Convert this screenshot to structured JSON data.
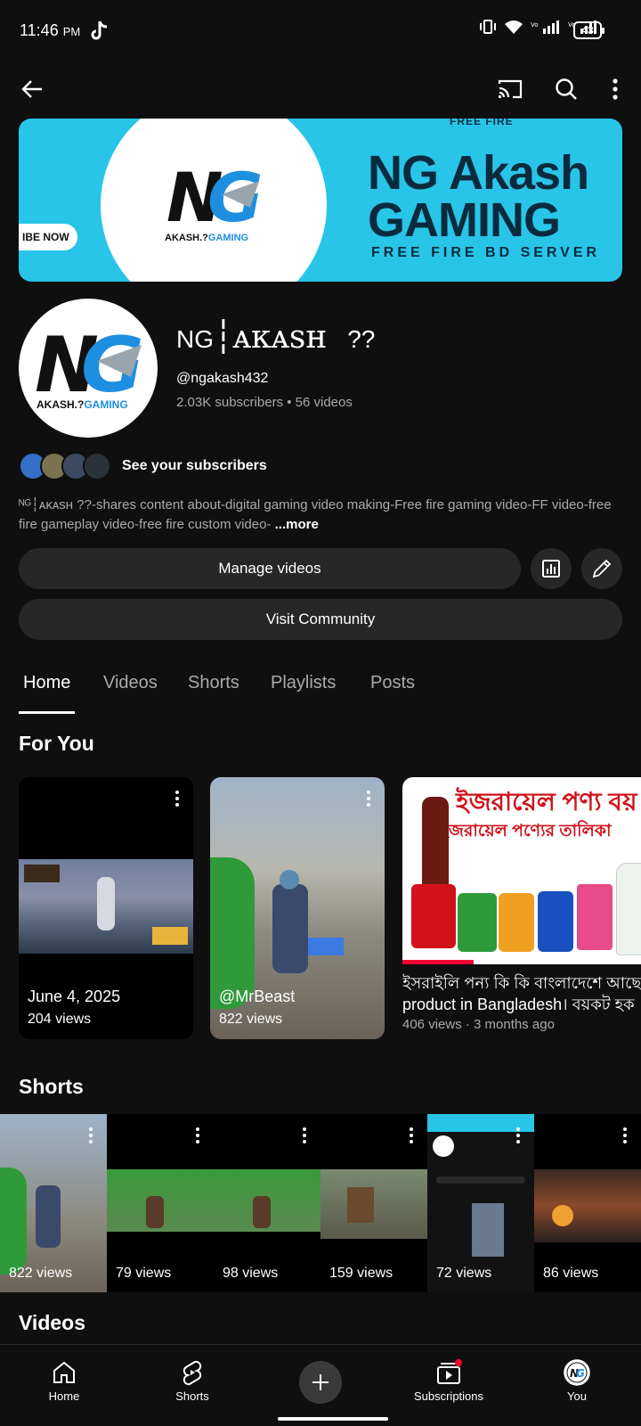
{
  "status_bar": {
    "time": "11:46",
    "ampm": "PM",
    "battery": "43"
  },
  "app_bar": {
    "icons": [
      "back-arrow-icon",
      "cast-icon",
      "search-icon",
      "more-vert-icon"
    ]
  },
  "banner": {
    "top_text": "FREE FIRE",
    "subscribe_pill": "IBE NOW",
    "title_line1": "NG Akash",
    "title_line2": "GAMING",
    "subtitle": "FREE FIRE BD SERVER",
    "logo_text": "AKASH.?",
    "logo_text_accent": "GAMING"
  },
  "channel": {
    "name_prefix": "NG",
    "name_main": "┆ᴀᴋᴀsʜ",
    "name_suffix": "??",
    "handle": "@ngakash432",
    "stats": "2.03K subscribers • 56 videos",
    "see_subscribers": "See your subscribers",
    "description": "ᴺᴳ┆ᴀᴋᴀsʜ   ??-shares content about-digital gaming video making-Free fire gaming video-FF video-free fire  gameplay video-free fire custom video-",
    "more": "...more"
  },
  "buttons": {
    "manage_videos": "Manage videos",
    "visit_community": "Visit Community"
  },
  "tabs": [
    "Home",
    "Videos",
    "Shorts",
    "Playlists",
    "Posts"
  ],
  "sections": {
    "for_you": "For You",
    "shorts": "Shorts",
    "videos": "Videos"
  },
  "for_you_cards": [
    {
      "title": "June 4, 2025",
      "views": "204 views"
    },
    {
      "title": "@MrBeast",
      "views": "822 views"
    }
  ],
  "wide_video": {
    "thumb_line1": "ইজরায়েল পণ্য বয়",
    "thumb_line2": "ইজরায়েল পণ্যের তালিকা",
    "title_line1": "ইসরাইলি পন্য কি কি বাংলাদেশে আছে",
    "title_line2": "product in Bangladesh। বয়কট হক",
    "meta": "406 views · 3 months ago"
  },
  "shorts": [
    {
      "views": "822 views"
    },
    {
      "views": "79 views"
    },
    {
      "views": "98 views"
    },
    {
      "views": "159 views"
    },
    {
      "views": "72 views"
    },
    {
      "views": "86 views"
    }
  ],
  "bottom_nav": [
    {
      "label": "Home",
      "icon": "home-icon"
    },
    {
      "label": "Shorts",
      "icon": "shorts-icon"
    },
    {
      "label": "",
      "icon": "create-plus-icon"
    },
    {
      "label": "Subscriptions",
      "icon": "subscriptions-icon"
    },
    {
      "label": "You",
      "icon": "profile-avatar-icon"
    }
  ],
  "colors": {
    "background": "#0f0f0f",
    "surface": "#272727",
    "banner": "#28c5e8",
    "logo_blue": "#1e8fe0",
    "accent_red": "#ff0033"
  }
}
